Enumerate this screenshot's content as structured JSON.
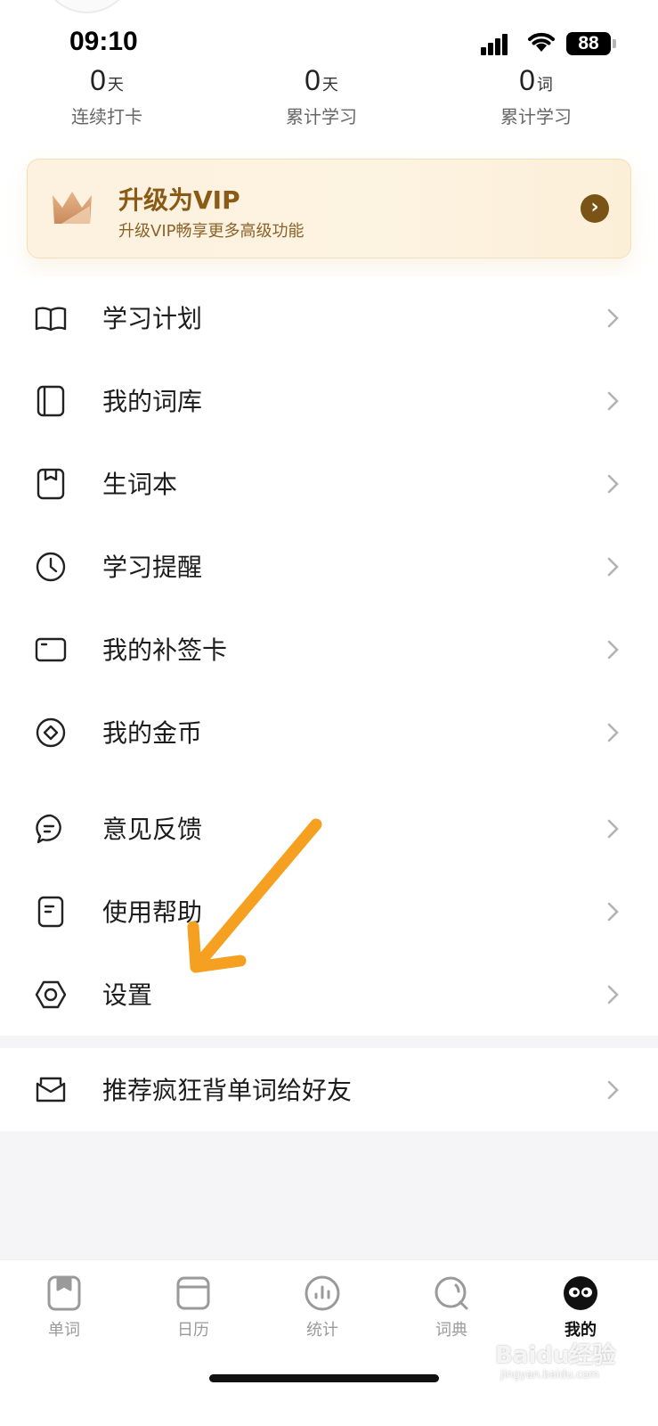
{
  "status_bar": {
    "time": "09:10",
    "battery": "88"
  },
  "stats": [
    {
      "value": "0",
      "unit": "天",
      "label": "连续打卡"
    },
    {
      "value": "0",
      "unit": "天",
      "label": "累计学习"
    },
    {
      "value": "0",
      "unit": "词",
      "label": "累计学习"
    }
  ],
  "vip": {
    "title": "升级为VIP",
    "subtitle": "升级VIP畅享更多高级功能",
    "accent": "#8a5a17"
  },
  "menu": {
    "group1": [
      {
        "label": "学习计划",
        "icon": "book-open-icon"
      },
      {
        "label": "我的词库",
        "icon": "notebook-icon"
      },
      {
        "label": "生词本",
        "icon": "bookmark-book-icon"
      },
      {
        "label": "学习提醒",
        "icon": "clock-icon"
      },
      {
        "label": "我的补签卡",
        "icon": "card-icon"
      },
      {
        "label": "我的金币",
        "icon": "coin-icon"
      }
    ],
    "group2": [
      {
        "label": "意见反馈",
        "icon": "chat-bubble-icon"
      },
      {
        "label": "使用帮助",
        "icon": "help-doc-icon"
      },
      {
        "label": "设置",
        "icon": "gear-hexagon-icon"
      }
    ],
    "group3": [
      {
        "label": "推荐疯狂背单词给好友",
        "icon": "envelope-icon"
      }
    ]
  },
  "tabbar": [
    {
      "label": "单词",
      "icon": "word-book-icon",
      "active": false
    },
    {
      "label": "日历",
      "icon": "calendar-icon",
      "active": false
    },
    {
      "label": "统计",
      "icon": "stats-icon",
      "active": false
    },
    {
      "label": "词典",
      "icon": "dictionary-search-icon",
      "active": false
    },
    {
      "label": "我的",
      "icon": "profile-mascot-icon",
      "active": true
    }
  ],
  "watermark": {
    "brand": "Baidu经验",
    "domain": "jingyan.baidu.com"
  },
  "colors": {
    "annotation_arrow": "#f5a020",
    "vip_background": "#fdf2df"
  }
}
